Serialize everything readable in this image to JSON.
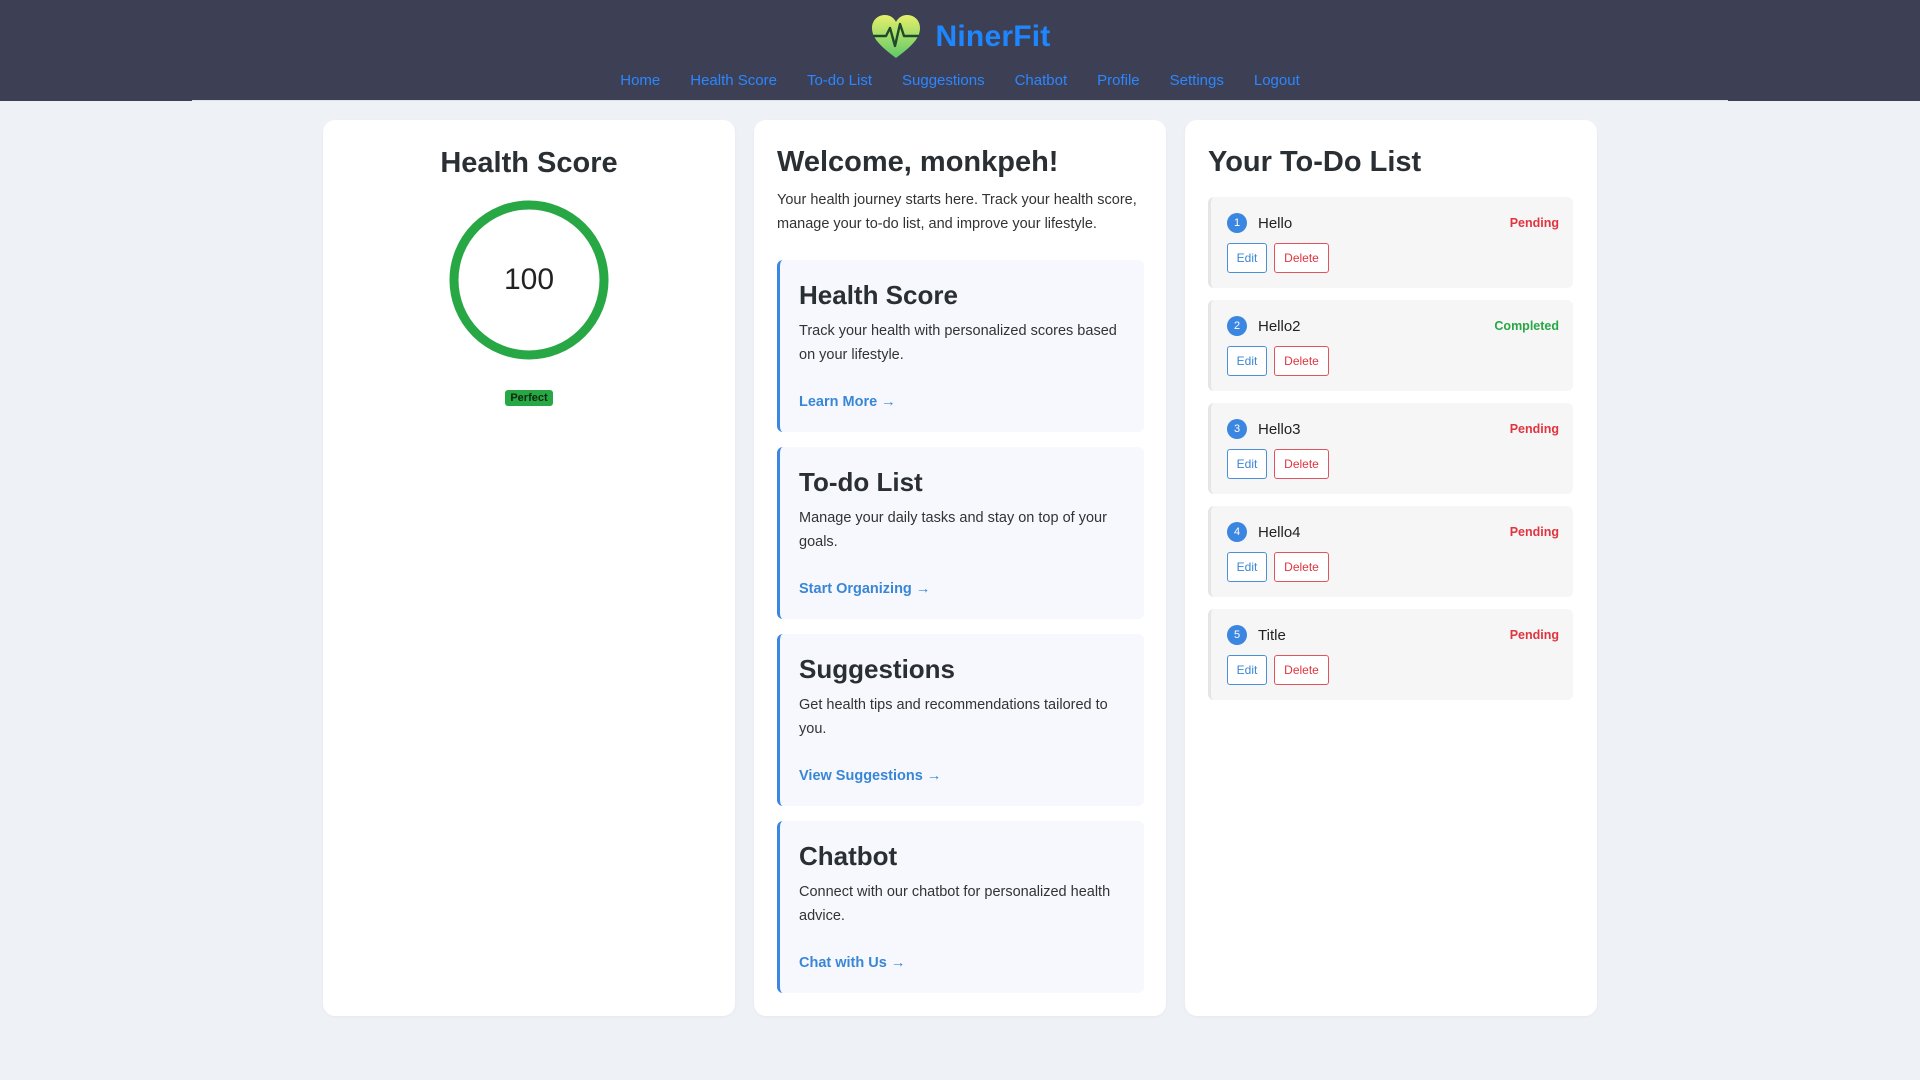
{
  "app": {
    "name": "NinerFit"
  },
  "nav": {
    "items": [
      "Home",
      "Health Score",
      "To-do List",
      "Suggestions",
      "Chatbot",
      "Profile",
      "Settings",
      "Logout"
    ]
  },
  "health_score": {
    "title": "Health Score",
    "value": "100",
    "progress": 1.0,
    "badge": "Perfect",
    "ring_color": "#28a745"
  },
  "welcome": {
    "title": "Welcome, monkpeh!",
    "intro": "Your health journey starts here. Track your health score, manage your to-do list, and improve your lifestyle.",
    "features": [
      {
        "title": "Health Score",
        "description": "Track your health with personalized scores based on your lifestyle.",
        "link": "Learn More →"
      },
      {
        "title": "To-do List",
        "description": "Manage your daily tasks and stay on top of your goals.",
        "link": "Start Organizing →"
      },
      {
        "title": "Suggestions",
        "description": "Get health tips and recommendations tailored to you.",
        "link": "View Suggestions →"
      },
      {
        "title": "Chatbot",
        "description": "Connect with our chatbot for personalized health advice.",
        "link": "Chat with Us →"
      }
    ]
  },
  "todo": {
    "title": "Your To-Do List",
    "edit_label": "Edit",
    "delete_label": "Delete",
    "items": [
      {
        "num": "1",
        "title": "Hello",
        "status": "Pending"
      },
      {
        "num": "2",
        "title": "Hello2",
        "status": "Completed"
      },
      {
        "num": "3",
        "title": "Hello3",
        "status": "Pending"
      },
      {
        "num": "4",
        "title": "Hello4",
        "status": "Pending"
      },
      {
        "num": "5",
        "title": "Title",
        "status": "Pending"
      }
    ]
  },
  "colors": {
    "header_bg": "#3d4055",
    "brand": "#1e87ff",
    "accent": "#3b86e0",
    "pending": "#e0343f",
    "completed": "#28a745"
  }
}
